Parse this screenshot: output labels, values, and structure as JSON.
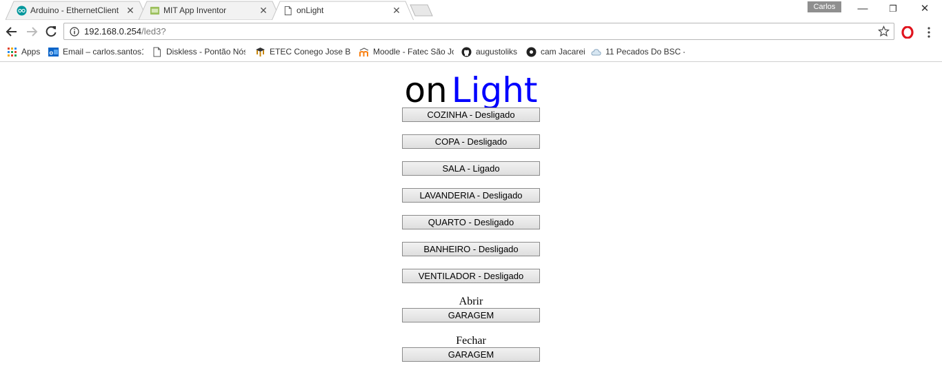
{
  "browser": {
    "tabs": [
      {
        "title": "Arduino - EthernetClient",
        "icon": "arduino-icon"
      },
      {
        "title": "MIT App Inventor",
        "icon": "app-inventor-icon"
      },
      {
        "title": "onLight",
        "icon": "page-icon",
        "active": true
      }
    ],
    "profile_name": "Carlos",
    "url_host": "192.168.0.254",
    "url_path": "/led3?",
    "bookmarks": [
      {
        "label": "Apps",
        "icon": "apps-grid-icon"
      },
      {
        "label": "Email – carlos.santos1",
        "icon": "outlook-icon"
      },
      {
        "label": "Diskless - Pontão Nós",
        "icon": "page-icon"
      },
      {
        "label": "ETEC Conego Jose Be",
        "icon": "graduation-cap-icon"
      },
      {
        "label": "Moodle - Fatec São Jo",
        "icon": "moodle-icon"
      },
      {
        "label": "augustoliks",
        "icon": "github-icon"
      },
      {
        "label": "cam Jacarei",
        "icon": "camera-icon"
      },
      {
        "label": "11 Pecados Do BSC - I",
        "icon": "cloud-icon"
      }
    ]
  },
  "page": {
    "logo_part1": "on",
    "logo_part2": "Light",
    "rooms": [
      {
        "label": "COZINHA - Desligado"
      },
      {
        "label": "COPA - Desligado"
      },
      {
        "label": "SALA - Ligado"
      },
      {
        "label": "LAVANDERIA - Desligado"
      },
      {
        "label": "QUARTO - Desligado"
      },
      {
        "label": "BANHEIRO - Desligado"
      },
      {
        "label": "VENTILADOR - Desligado"
      }
    ],
    "garage_open_caption": "Abrir",
    "garage_open_button": "GARAGEM",
    "garage_close_caption": "Fechar",
    "garage_close_button": "GARAGEM"
  },
  "colors": {
    "logo_light": "#0000ff"
  }
}
